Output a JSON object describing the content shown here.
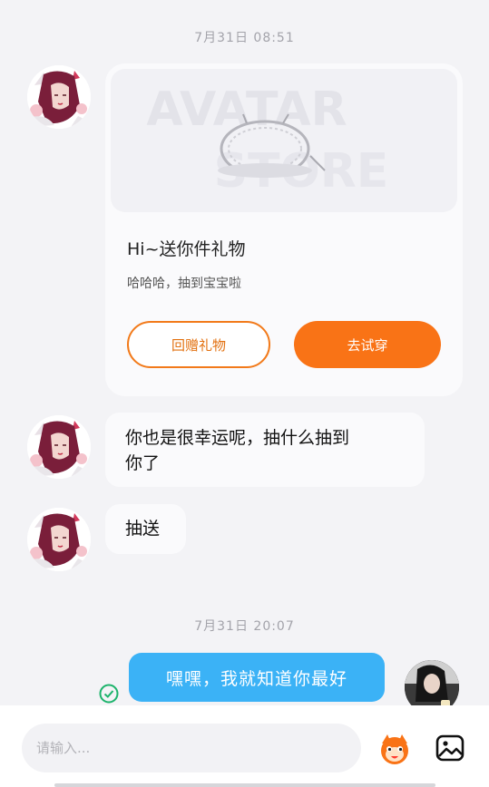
{
  "timestamps": [
    "7月31日 08:51",
    "7月31日 20:07"
  ],
  "gift_card": {
    "banner_text_top": "AVATAR",
    "banner_text_bottom": "STORE",
    "title": "Hi~送你件礼物",
    "subtitle": "哈哈哈，抽到宝宝啦",
    "return_button": "回赠礼物",
    "try_button": "去试穿"
  },
  "messages": {
    "incoming_1_line_1": "你也是很幸运呢，抽什么抽到",
    "incoming_1_line_2": "你了",
    "incoming_2": "抽送",
    "outgoing_1": "嘿嘿，我就知道你最好"
  },
  "input": {
    "placeholder": "请输入..."
  },
  "icons": {
    "sent_status": "check-circle-icon",
    "emoji": "emoji-sticker-icon",
    "image": "image-icon"
  },
  "colors": {
    "accent_orange": "#f97316",
    "outgoing_bubble": "#3bb2f6",
    "sent_check": "#1cb36b"
  }
}
